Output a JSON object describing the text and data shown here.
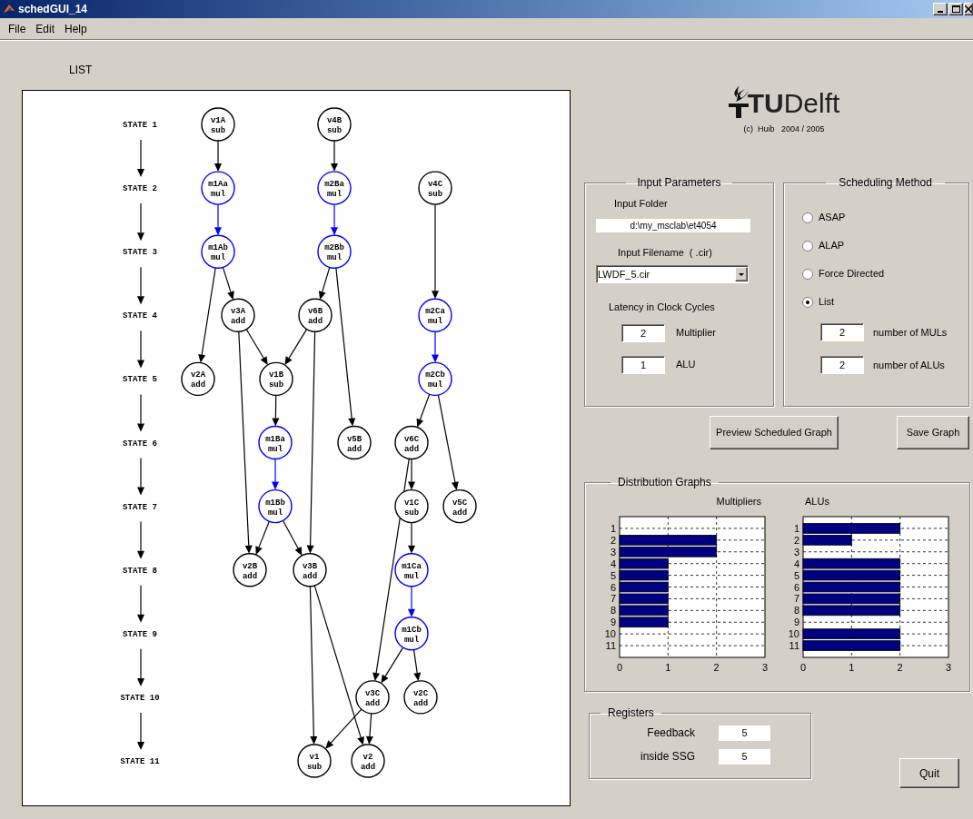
{
  "window": {
    "title": "schedGUI_14"
  },
  "menu": [
    "File",
    "Edit",
    "Help"
  ],
  "method_label": "LIST",
  "graph": {
    "states": [
      "STATE 1",
      "STATE 2",
      "STATE 3",
      "STATE 4",
      "STATE 5",
      "STATE 6",
      "STATE 7",
      "STATE 8",
      "STATE 9",
      "STATE 10",
      "STATE 11"
    ],
    "nodes": [
      {
        "name": "v1A",
        "op": "sub",
        "color": "#000000"
      },
      {
        "name": "v4B",
        "op": "sub",
        "color": "#000000"
      },
      {
        "name": "m1Aa",
        "op": "mul",
        "color": "#0000ff"
      },
      {
        "name": "m2Ba",
        "op": "mul",
        "color": "#0000ff"
      },
      {
        "name": "v4C",
        "op": "sub",
        "color": "#000000"
      },
      {
        "name": "m1Ab",
        "op": "mul",
        "color": "#0000ff"
      },
      {
        "name": "m2Bb",
        "op": "mul",
        "color": "#0000ff"
      },
      {
        "name": "v3A",
        "op": "add",
        "color": "#000000"
      },
      {
        "name": "v6B",
        "op": "add",
        "color": "#000000"
      },
      {
        "name": "m2Ca",
        "op": "mul",
        "color": "#0000ff"
      },
      {
        "name": "v2A",
        "op": "add",
        "color": "#000000"
      },
      {
        "name": "v1B",
        "op": "sub",
        "color": "#000000"
      },
      {
        "name": "m2Cb",
        "op": "mul",
        "color": "#0000ff"
      },
      {
        "name": "m1Ba",
        "op": "mul",
        "color": "#0000ff"
      },
      {
        "name": "v5B",
        "op": "add",
        "color": "#000000"
      },
      {
        "name": "v6C",
        "op": "add",
        "color": "#000000"
      },
      {
        "name": "m1Bb",
        "op": "mul",
        "color": "#0000ff"
      },
      {
        "name": "v1C",
        "op": "sub",
        "color": "#000000"
      },
      {
        "name": "v5C",
        "op": "add",
        "color": "#000000"
      },
      {
        "name": "v2B",
        "op": "add",
        "color": "#000000"
      },
      {
        "name": "v3B",
        "op": "add",
        "color": "#000000"
      },
      {
        "name": "m1Ca",
        "op": "mul",
        "color": "#0000ff"
      },
      {
        "name": "m1Cb",
        "op": "mul",
        "color": "#0000ff"
      },
      {
        "name": "v3C",
        "op": "add",
        "color": "#000000"
      },
      {
        "name": "v2C",
        "op": "add",
        "color": "#000000"
      },
      {
        "name": "v1",
        "op": "sub",
        "color": "#000000"
      },
      {
        "name": "v2",
        "op": "add",
        "color": "#000000"
      }
    ]
  },
  "logo": {
    "text": "**TU**Delft",
    "credit": "(c)  Huib   2004 / 2005"
  },
  "input_parameters": {
    "title": "Input Parameters",
    "folder_label": "Input Folder",
    "folder": "d:\\my_msclab\\et4054",
    "filename_label": "Input Filename  ( .cir)",
    "filename": "LWDF_5.cir",
    "latency_label": "Latency in Clock Cycles",
    "latencies": [
      {
        "value": "2",
        "label": "Multiplier"
      },
      {
        "value": "1",
        "label": "ALU"
      }
    ]
  },
  "scheduling": {
    "title": "Scheduling Method",
    "options": [
      {
        "label": "ASAP",
        "selected": false
      },
      {
        "label": "ALAP",
        "selected": false
      },
      {
        "label": "Force Directed",
        "selected": false
      },
      {
        "label": "List",
        "selected": true
      }
    ],
    "counts": [
      {
        "value": "2",
        "label": "number of MULs"
      },
      {
        "value": "2",
        "label": "number of ALUs"
      }
    ]
  },
  "buttons": {
    "preview": "Preview Scheduled Graph",
    "save": "Save Graph",
    "quit": "Quit"
  },
  "distribution": {
    "title": "Distribution Graphs",
    "multipliers": {
      "chart_data": {
        "type": "bar",
        "orientation": "horizontal",
        "title": "Multipliers",
        "categories": [
          "1",
          "2",
          "3",
          "4",
          "5",
          "6",
          "7",
          "8",
          "9",
          "10",
          "11"
        ],
        "series": [
          {
            "color": "#000080",
            "values": [
              0,
              2,
              2,
              1,
              1,
              1,
              1,
              1,
              1,
              0,
              0
            ]
          }
        ],
        "xlim": [
          0,
          3
        ],
        "xticks": [
          0,
          1,
          2,
          3
        ]
      }
    },
    "alus": {
      "chart_data": {
        "type": "bar",
        "orientation": "horizontal",
        "title": "ALUs",
        "categories": [
          "1",
          "2",
          "3",
          "4",
          "5",
          "6",
          "7",
          "8",
          "9",
          "10",
          "11"
        ],
        "series": [
          {
            "color": "#000080",
            "values": [
              2,
              1,
              0,
              2,
              2,
              2,
              2,
              2,
              0,
              2,
              2
            ]
          }
        ],
        "xlim": [
          0,
          3
        ],
        "xticks": [
          0,
          1,
          2,
          3
        ]
      }
    }
  },
  "registers": {
    "title": "Registers",
    "rows": [
      {
        "label": "Feedback",
        "value": "5"
      },
      {
        "label": "inside SSG",
        "value": "5"
      }
    ]
  }
}
